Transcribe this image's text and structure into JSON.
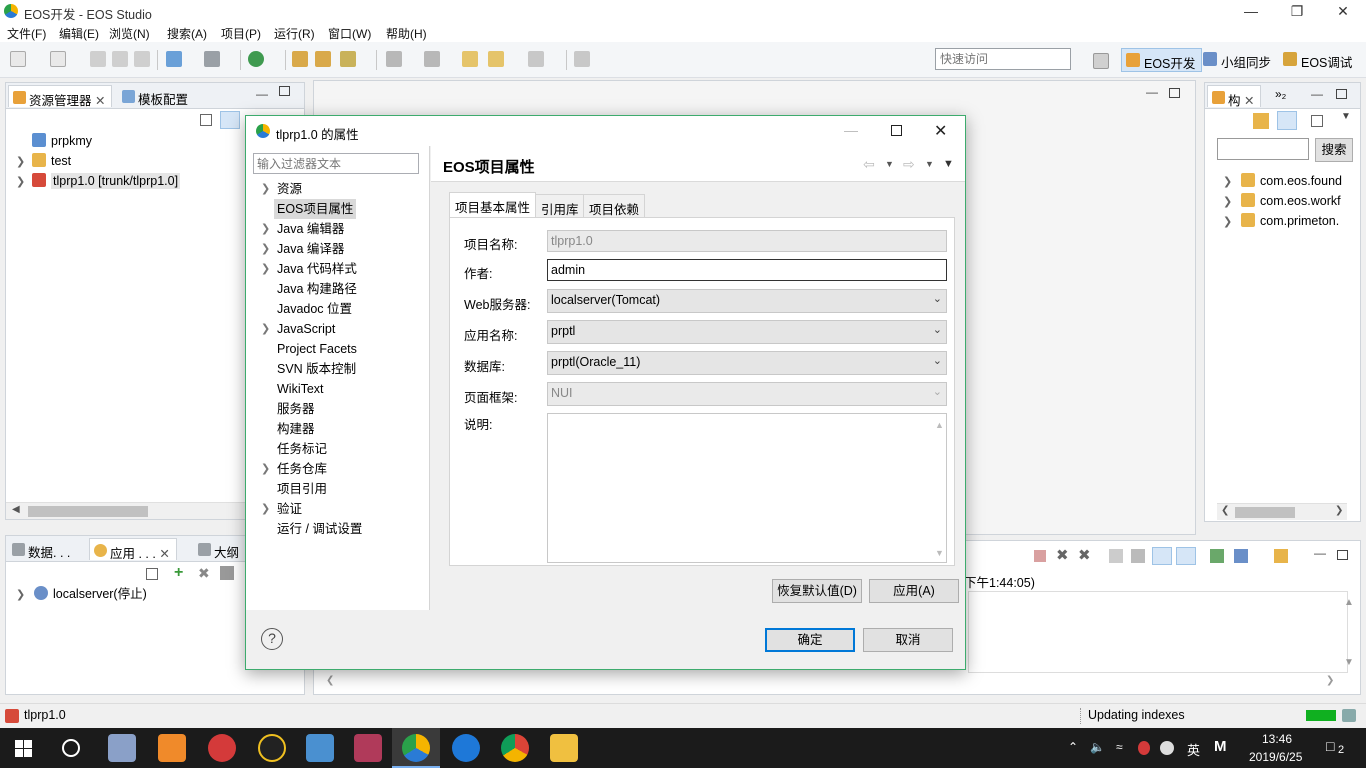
{
  "window": {
    "title": "EOS开发 - EOS Studio"
  },
  "menu": [
    "文件(F)",
    "编辑(E)",
    "浏览(N)",
    "搜索(A)",
    "项目(P)",
    "运行(R)",
    "窗口(W)",
    "帮助(H)"
  ],
  "toolbar": {
    "quick_access_placeholder": "快速访问"
  },
  "perspectives": [
    {
      "label": "EOS开发",
      "active": true
    },
    {
      "label": "小组同步",
      "active": false
    },
    {
      "label": "EOS调试",
      "active": false
    }
  ],
  "explorer": {
    "tabs": [
      "资源管理器",
      "模板配置"
    ],
    "items": [
      {
        "label": "prpkmy",
        "expandable": false
      },
      {
        "label": "test",
        "expandable": true
      },
      {
        "label": "tlprp1.0 [trunk/tlprp1.0]",
        "expandable": true
      }
    ]
  },
  "server_panel": {
    "tabs": [
      "数据. . .",
      "应用 . . .",
      "大纲"
    ],
    "items": [
      {
        "label": "localserver(停止)"
      }
    ]
  },
  "outline": {
    "tabs": [
      "构",
      "»₂"
    ],
    "search_button": "搜索",
    "items": [
      "com.eos.found",
      "com.eos.workf",
      "com.primeton."
    ]
  },
  "console": {
    "text": "下午1:44:05)"
  },
  "dialog": {
    "title": "tlprp1.0 的属性",
    "filter_placeholder": "输入过滤器文本",
    "nav": [
      {
        "label": "资源",
        "arrow": true
      },
      {
        "label": "EOS项目属性",
        "arrow": false,
        "selected": true
      },
      {
        "label": "Java 编辑器",
        "arrow": true
      },
      {
        "label": "Java 编译器",
        "arrow": true
      },
      {
        "label": "Java 代码样式",
        "arrow": true
      },
      {
        "label": "Java 构建路径",
        "arrow": false
      },
      {
        "label": "Javadoc 位置",
        "arrow": false
      },
      {
        "label": "JavaScript",
        "arrow": true
      },
      {
        "label": "Project Facets",
        "arrow": false
      },
      {
        "label": "SVN 版本控制",
        "arrow": false
      },
      {
        "label": "WikiText",
        "arrow": false
      },
      {
        "label": "服务器",
        "arrow": false
      },
      {
        "label": "构建器",
        "arrow": false
      },
      {
        "label": "任务标记",
        "arrow": false
      },
      {
        "label": "任务仓库",
        "arrow": true
      },
      {
        "label": "项目引用",
        "arrow": false
      },
      {
        "label": "验证",
        "arrow": true
      },
      {
        "label": "运行 / 调试设置",
        "arrow": false
      }
    ],
    "page_title": "EOS项目属性",
    "tabs": [
      "项目基本属性",
      "引用库",
      "项目依赖"
    ],
    "fields": {
      "project_name": {
        "label": "项目名称:",
        "value": "tlprp1.0"
      },
      "author": {
        "label": "作者:",
        "value": "admin"
      },
      "web_server": {
        "label": "Web服务器:",
        "value": "localserver(Tomcat)"
      },
      "app_name": {
        "label": "应用名称:",
        "value": "prptl"
      },
      "database": {
        "label": "数据库:",
        "value": "prptl(Oracle_11)"
      },
      "frame": {
        "label": "页面框架:",
        "value": "NUI"
      },
      "description": {
        "label": "说明:",
        "value": ""
      }
    },
    "restore_button": "恢复默认值(D)",
    "apply_button": "应用(A)",
    "ok_button": "确定",
    "cancel_button": "取消",
    "help_glyph": "?"
  },
  "statusbar": {
    "left": "tlprp1.0",
    "right": "Updating indexes"
  },
  "taskbar": {
    "ime": "英",
    "time": "13:46",
    "date": "2019/6/25",
    "notification_count": "2"
  },
  "colors": {
    "accent_green": "#3dab6d",
    "selection_blue": "#0078d7"
  }
}
